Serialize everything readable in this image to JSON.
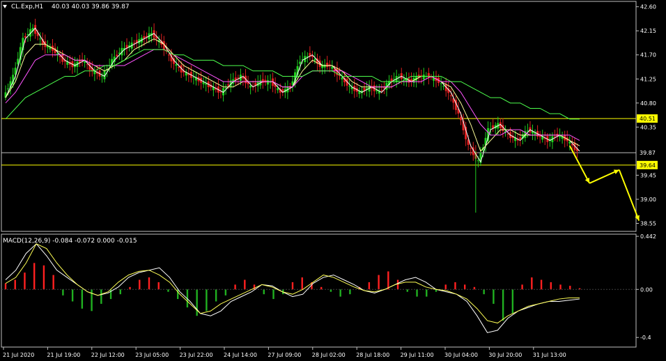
{
  "header": {
    "symbol": "CL.Exp,H1",
    "ohlc": "40.03 40.03 39.86 39.87"
  },
  "chart_data": [
    {
      "type": "line",
      "ylim": [
        38.4,
        42.7
      ],
      "yticks": [
        42.6,
        42.15,
        41.7,
        41.25,
        40.8,
        40.35,
        39.45,
        39.0,
        38.55
      ],
      "ytick_labels": [
        "42.60",
        "42.15",
        "41.70",
        "41.25",
        "40.80",
        "40.35",
        "39.45",
        "39.00",
        "38.55"
      ],
      "xtick_labels": [
        "21 Jul 2020",
        "21 Jul 19:00",
        "22 Jul 12:00",
        "23 Jul 05:00",
        "23 Jul 22:00",
        "24 Jul 14:00",
        "27 Jul 09:00",
        "28 Jul 02:00",
        "28 Jul 18:00",
        "29 Jul 11:00",
        "30 Jul 04:00",
        "30 Jul 20:00",
        "31 Jul 13:00"
      ],
      "grid": false,
      "levels": [
        {
          "value": 40.51,
          "label": "40.51",
          "color": "#ffff00",
          "boxed": true
        },
        {
          "value": 39.87,
          "label": "39.87",
          "color": "#c0c0c0",
          "boxed": false
        },
        {
          "value": 39.64,
          "label": "39.64",
          "color": "#ffff00",
          "boxed": true
        }
      ],
      "series": [
        {
          "role": "price",
          "color": "#ffffff",
          "values": [
            40.9,
            41.3,
            42.0,
            42.2,
            41.9,
            41.8,
            41.6,
            41.5,
            41.6,
            41.4,
            41.3,
            41.6,
            41.8,
            41.9,
            42.0,
            42.1,
            41.9,
            41.6,
            41.4,
            41.3,
            41.2,
            41.1,
            41.0,
            41.2,
            41.3,
            41.1,
            41.2,
            41.2,
            41.0,
            41.1,
            41.6,
            41.7,
            41.5,
            41.5,
            41.3,
            41.1,
            41.0,
            41.1,
            41.0,
            41.2,
            41.3,
            41.2,
            41.3,
            41.3,
            41.2,
            41.0,
            40.6,
            40.0,
            39.7,
            40.3,
            40.4,
            40.2,
            40.1,
            40.3,
            40.2,
            40.1,
            40.2,
            40.1,
            39.9
          ]
        },
        {
          "role": "ma-fast",
          "color": "#ffff99",
          "values": [
            40.9,
            41.2,
            41.7,
            41.9,
            41.9,
            41.8,
            41.7,
            41.6,
            41.6,
            41.5,
            41.4,
            41.5,
            41.6,
            41.8,
            41.9,
            42.0,
            41.9,
            41.7,
            41.5,
            41.4,
            41.3,
            41.2,
            41.1,
            41.1,
            41.2,
            41.2,
            41.2,
            41.2,
            41.1,
            41.1,
            41.4,
            41.6,
            41.5,
            41.5,
            41.4,
            41.2,
            41.1,
            41.1,
            41.1,
            41.1,
            41.2,
            41.2,
            41.3,
            41.3,
            41.2,
            41.1,
            40.8,
            40.4,
            39.9,
            40.1,
            40.3,
            40.3,
            40.2,
            40.2,
            40.2,
            40.2,
            40.2,
            40.1,
            40.0
          ]
        },
        {
          "role": "ma-mid",
          "color": "#ff55ff",
          "values": [
            40.8,
            41.0,
            41.3,
            41.6,
            41.7,
            41.7,
            41.7,
            41.6,
            41.6,
            41.5,
            41.5,
            41.5,
            41.5,
            41.6,
            41.7,
            41.8,
            41.8,
            41.7,
            41.6,
            41.5,
            41.4,
            41.3,
            41.2,
            41.2,
            41.2,
            41.2,
            41.2,
            41.2,
            41.1,
            41.1,
            41.3,
            41.4,
            41.4,
            41.4,
            41.4,
            41.3,
            41.2,
            41.1,
            41.1,
            41.1,
            41.2,
            41.2,
            41.2,
            41.3,
            41.2,
            41.2,
            41.0,
            40.7,
            40.4,
            40.2,
            40.2,
            40.3,
            40.3,
            40.2,
            40.2,
            40.2,
            40.2,
            40.2,
            40.1
          ]
        },
        {
          "role": "ma-slow",
          "color": "#4dff4d",
          "values": [
            40.5,
            40.7,
            40.9,
            41.0,
            41.1,
            41.2,
            41.3,
            41.3,
            41.4,
            41.4,
            41.5,
            41.5,
            41.6,
            41.7,
            41.8,
            41.8,
            41.8,
            41.7,
            41.7,
            41.6,
            41.6,
            41.6,
            41.5,
            41.5,
            41.5,
            41.4,
            41.4,
            41.4,
            41.3,
            41.3,
            41.3,
            41.4,
            41.4,
            41.4,
            41.3,
            41.3,
            41.3,
            41.3,
            41.2,
            41.2,
            41.2,
            41.3,
            41.3,
            41.3,
            41.3,
            41.2,
            41.2,
            41.1,
            41.0,
            40.9,
            40.9,
            40.8,
            40.8,
            40.7,
            40.7,
            40.6,
            40.6,
            40.5,
            40.5
          ]
        }
      ],
      "forecast_arrows": [
        {
          "from": [
            57,
            40.0
          ],
          "to": [
            59,
            39.3
          ]
        },
        {
          "from": [
            59,
            39.3
          ],
          "to": [
            62,
            39.55
          ]
        },
        {
          "from": [
            62,
            39.55
          ],
          "to": [
            64,
            38.6
          ]
        }
      ]
    },
    {
      "type": "bar",
      "title": "MACD(12,26,9) -0.084 -0.072 0.000 -0.015",
      "ylim": [
        -0.48,
        0.46
      ],
      "yticks": [
        0.442,
        0.0,
        -0.4
      ],
      "ytick_labels": [
        "0.442",
        "0.00",
        "-0.4"
      ],
      "positive_color": "#ff2020",
      "negative_color": "#20b020",
      "histogram": [
        0.05,
        0.08,
        0.14,
        0.22,
        0.2,
        0.12,
        -0.05,
        -0.1,
        -0.16,
        -0.18,
        -0.12,
        -0.08,
        -0.04,
        0.02,
        0.08,
        0.1,
        0.06,
        -0.02,
        -0.08,
        -0.15,
        -0.22,
        -0.18,
        -0.1,
        -0.05,
        0.04,
        0.08,
        0.04,
        -0.04,
        -0.08,
        -0.04,
        0.06,
        0.1,
        0.06,
        0.02,
        -0.02,
        -0.06,
        -0.04,
        0.02,
        0.06,
        0.12,
        0.15,
        0.08,
        -0.02,
        -0.06,
        -0.06,
        -0.02,
        0.04,
        0.06,
        0.04,
        0.02,
        -0.04,
        -0.12,
        -0.26,
        -0.2,
        0.04,
        0.1,
        0.08,
        0.06,
        0.04,
        0.03,
        0.01
      ],
      "series": [
        {
          "role": "macd",
          "color": "#ffffff",
          "values": [
            0.08,
            0.16,
            0.3,
            0.38,
            0.28,
            0.16,
            0.1,
            0.04,
            -0.02,
            -0.05,
            -0.03,
            0.02,
            0.1,
            0.14,
            0.16,
            0.18,
            0.1,
            -0.02,
            -0.1,
            -0.2,
            -0.22,
            -0.18,
            -0.1,
            -0.06,
            -0.02,
            0.04,
            0.03,
            -0.02,
            -0.06,
            -0.04,
            0.05,
            0.1,
            0.12,
            0.08,
            0.04,
            -0.01,
            -0.03,
            0.0,
            0.04,
            0.08,
            0.1,
            0.06,
            0.0,
            -0.02,
            -0.04,
            -0.1,
            -0.22,
            -0.36,
            -0.34,
            -0.24,
            -0.18,
            -0.15,
            -0.12,
            -0.1,
            -0.1,
            -0.09,
            -0.08
          ]
        },
        {
          "role": "signal",
          "color": "#ffff55",
          "values": [
            0.05,
            0.1,
            0.22,
            0.38,
            0.34,
            0.22,
            0.12,
            0.04,
            -0.02,
            -0.05,
            -0.02,
            0.06,
            0.12,
            0.15,
            0.16,
            0.12,
            0.06,
            -0.04,
            -0.12,
            -0.2,
            -0.18,
            -0.12,
            -0.08,
            -0.04,
            0.0,
            0.04,
            0.02,
            -0.02,
            -0.04,
            0.0,
            0.06,
            0.12,
            0.1,
            0.06,
            0.02,
            -0.01,
            -0.02,
            0.0,
            0.04,
            0.06,
            0.06,
            0.02,
            0.0,
            -0.01,
            -0.04,
            -0.08,
            -0.16,
            -0.26,
            -0.28,
            -0.22,
            -0.18,
            -0.14,
            -0.12,
            -0.1,
            -0.08,
            -0.07,
            -0.07
          ]
        }
      ]
    }
  ]
}
